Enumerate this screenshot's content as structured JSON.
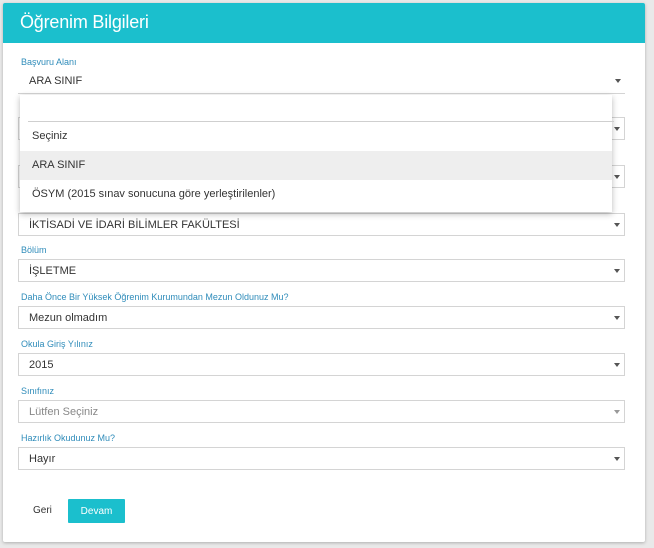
{
  "page": {
    "title": "Öğrenim Bilgileri"
  },
  "fields": {
    "basvuru_alani": {
      "label": "Başvuru Alanı",
      "value": "ARA SINIF"
    },
    "fakulte": {
      "value": "İKTİSADİ VE İDARİ BİLİMLER FAKÜLTESİ"
    },
    "bolum": {
      "label": "Bölüm",
      "value": "İŞLETME"
    },
    "mezun": {
      "label": "Daha Önce Bir Yüksek Öğrenim Kurumundan Mezun Oldunuz Mu?",
      "value": "Mezun olmadım"
    },
    "giris_yili": {
      "label": "Okula Giriş Yılınız",
      "value": "2015"
    },
    "sinif": {
      "label": "Sınıfınız",
      "value": "Lütfen Seçiniz"
    },
    "hazirlik": {
      "label": "Hazırlık Okudunuz Mu?",
      "value": "Hayır"
    }
  },
  "dropdown": {
    "search_value": "",
    "options": [
      "Seçiniz",
      "ARA SINIF",
      "ÖSYM (2015 sınav sonucuna göre yerleştirilenler)"
    ],
    "selected_index": 1
  },
  "buttons": {
    "back": "Geri",
    "next": "Devam"
  },
  "colors": {
    "accent": "#1bbfcd",
    "label": "#2f8cba"
  },
  "icons": {
    "caret": "caret-down-icon"
  }
}
